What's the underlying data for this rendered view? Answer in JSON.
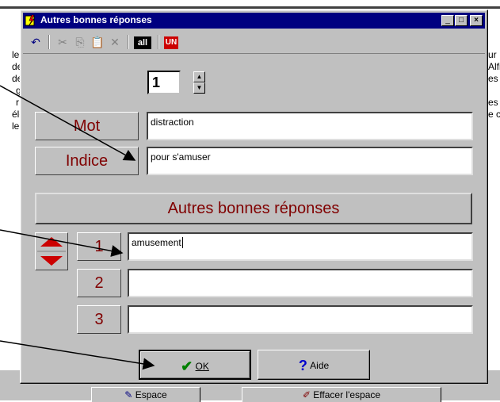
{
  "background": {
    "left_fragments": [
      "le",
      "de",
      "de",
      "g",
      "r",
      "éle",
      "le"
    ],
    "right_fragments": [
      "ur",
      "Alfi",
      "es",
      "es",
      "e c"
    ],
    "buttons": {
      "espace": "Espace",
      "effacer": "Effacer l'espace"
    }
  },
  "dialog": {
    "title": "Autres bonnes réponses",
    "title_buttons": {
      "minimize": "_",
      "maximize": "□",
      "close": "×"
    },
    "toolbar": {
      "all_label": "all",
      "uni_label": "UN"
    },
    "spinner": {
      "value": "1"
    },
    "mot": {
      "label": "Mot",
      "value": "distraction"
    },
    "indice": {
      "label": "Indice",
      "value": "pour s'amuser"
    },
    "section_title": "Autres bonnes réponses",
    "answers": [
      {
        "number": "1",
        "value": "amusement"
      },
      {
        "number": "2",
        "value": ""
      },
      {
        "number": "3",
        "value": ""
      }
    ],
    "ok_label": "OK",
    "aide_label": "Aide"
  },
  "colors": {
    "titlebar": "#000080",
    "face": "#c0c0c0",
    "label_text": "#800000",
    "arrow_red": "#cc0000",
    "check_green": "#008000",
    "help_blue": "#0000cc"
  }
}
